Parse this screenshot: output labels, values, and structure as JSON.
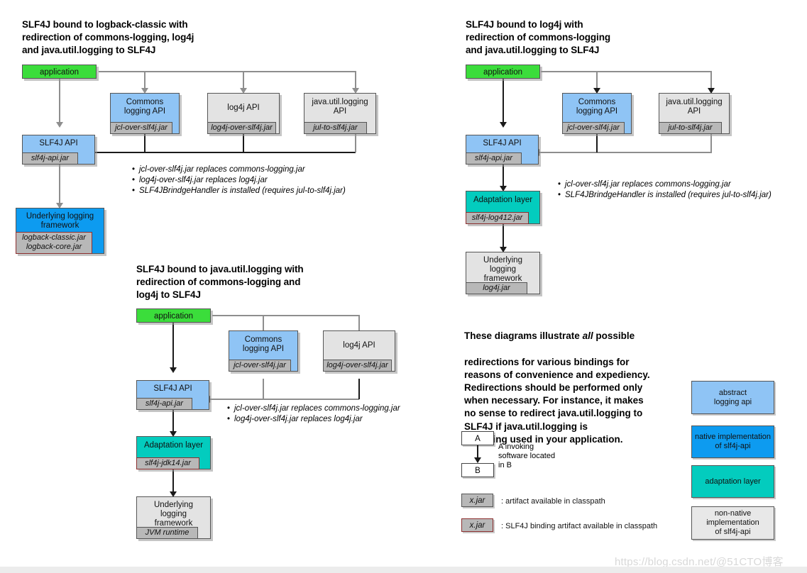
{
  "diagrams": [
    {
      "id": "logback-classic",
      "title": "SLF4J bound to logback-classic with\nredirection of commons-logging, log4j\nand java.util.logging to SLF4J",
      "nodes": {
        "application": "application",
        "commons": "Commons\nlogging API",
        "commons_jar": "jcl-over-slf4j.jar",
        "log4j": "log4j API",
        "log4j_jar": "log4j-over-slf4j.jar",
        "jul": "java.util.logging\nAPI",
        "jul_jar": "jul-to-slf4j.jar",
        "slf4j": "SLF4J API",
        "slf4j_jar": "slf4j-api.jar",
        "underlying": "Underlying logging\nframework",
        "underlying_jar": "logback-classic.jar\nlogback-core.jar"
      },
      "bullets": [
        "jcl-over-slf4j.jar replaces commons-logging.jar",
        "log4j-over-slf4j.jar replaces log4j.jar",
        "SLF4JBrindgeHandler is installed (requires jul-to-slf4j.jar)"
      ]
    },
    {
      "id": "log4j",
      "title": "SLF4J bound to log4j with\nredirection of commons-logging\nand java.util.logging to SLF4J",
      "nodes": {
        "application": "application",
        "commons": "Commons\nlogging API",
        "commons_jar": "jcl-over-slf4j.jar",
        "jul": "java.util.logging\nAPI",
        "jul_jar": "jul-to-slf4j.jar",
        "slf4j": "SLF4J API",
        "slf4j_jar": "slf4j-api.jar",
        "adaptation": "Adaptation layer",
        "adaptation_jar": "slf4j-log412.jar",
        "underlying": "Underlying\nlogging\nframework",
        "underlying_jar": "log4j.jar"
      },
      "bullets": [
        "jcl-over-slf4j.jar replaces commons-logging.jar",
        "SLF4JBrindgeHandler is installed (requires jul-to-slf4j.jar)"
      ]
    },
    {
      "id": "java-util-logging",
      "title": "SLF4J bound to java.util.logging with\nredirection of commons-logging and\nlog4j to SLF4J",
      "nodes": {
        "application": "application",
        "commons": "Commons\nlogging API",
        "commons_jar": "jcl-over-slf4j.jar",
        "log4j": "log4j API",
        "log4j_jar": "log4j-over-slf4j.jar",
        "slf4j": "SLF4J API",
        "slf4j_jar": "slf4j-api.jar",
        "adaptation": "Adaptation layer",
        "adaptation_jar": "slf4j-jdk14.jar",
        "underlying": "Underlying\nlogging\nframework",
        "underlying_jar": "JVM runtime"
      },
      "bullets": [
        "jcl-over-slf4j.jar replaces commons-logging.jar",
        "log4j-over-slf4j.jar replaces log4j.jar"
      ]
    }
  ],
  "note": {
    "line1": "These diagrams illustrate ",
    "emphasis": "all",
    "line1b": " possible",
    "rest": "redirections for various bindings for\nreasons of convenience and expediency.\nRedirections should be performed only\nwhen necessary. For instance, it makes\nno sense to redirect java.util.logging to\nSLF4J if java.util.logging is\nnot being used in your application."
  },
  "legend": {
    "invocation": {
      "box_a": "A",
      "box_b": "B",
      "caption": "A invoking\nsoftware located\nin B"
    },
    "artifact": {
      "label": "x.jar",
      "caption": ": artifact available in classpath"
    },
    "binding_artifact": {
      "label": "x.jar",
      "caption": ": SLF4J binding artifact available in classpath"
    },
    "swatches": [
      {
        "label": "abstract\nlogging api",
        "color": "#8fc4f5"
      },
      {
        "label": "native implementation\nof slf4j-api",
        "color": "#0d9bf0"
      },
      {
        "label": "adaptation layer",
        "color": "#03ccbe"
      },
      {
        "label": "non-native implementation\nof slf4j-api",
        "color": "#e8e8e8"
      }
    ]
  },
  "watermark": "https://blog.csdn.net/@51CTO博客",
  "colors": {
    "application_green": "#3bdd3b",
    "abstract_blue": "#8fc4f5",
    "native_blue": "#0d9bf0",
    "adaptation_teal": "#03ccbe",
    "nonnative_grey": "#e3e3e3",
    "jar_grey": "#b8b8b8",
    "binding_border": "#8c2f2f"
  }
}
